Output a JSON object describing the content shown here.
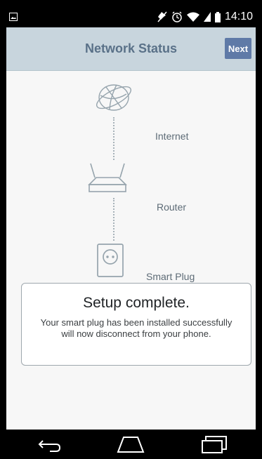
{
  "status_bar": {
    "time": "14:10",
    "icons": [
      "image-icon",
      "mute-icon",
      "alarm-icon",
      "wifi-icon",
      "signal-icon",
      "battery-icon"
    ]
  },
  "header": {
    "title": "Network Status",
    "next_label": "Next"
  },
  "diagram": {
    "nodes": [
      {
        "label": "Internet",
        "icon": "globe-icon"
      },
      {
        "label": "Router",
        "icon": "router-icon"
      },
      {
        "label": "Smart Plug",
        "icon": "smart-plug-icon"
      }
    ],
    "line_color": "#a7b2b9"
  },
  "result_card": {
    "title": "Setup complete.",
    "message": "Your smart plug has been installed successfully will now disconnect from your phone."
  },
  "nav_bar": {
    "buttons": [
      "back-icon",
      "home-icon",
      "recent-apps-icon"
    ]
  },
  "colors": {
    "header_bg": "#c8d5dd",
    "title": "#5a7188",
    "accent": "#5f7aa7",
    "icon": "#96a4ad"
  }
}
